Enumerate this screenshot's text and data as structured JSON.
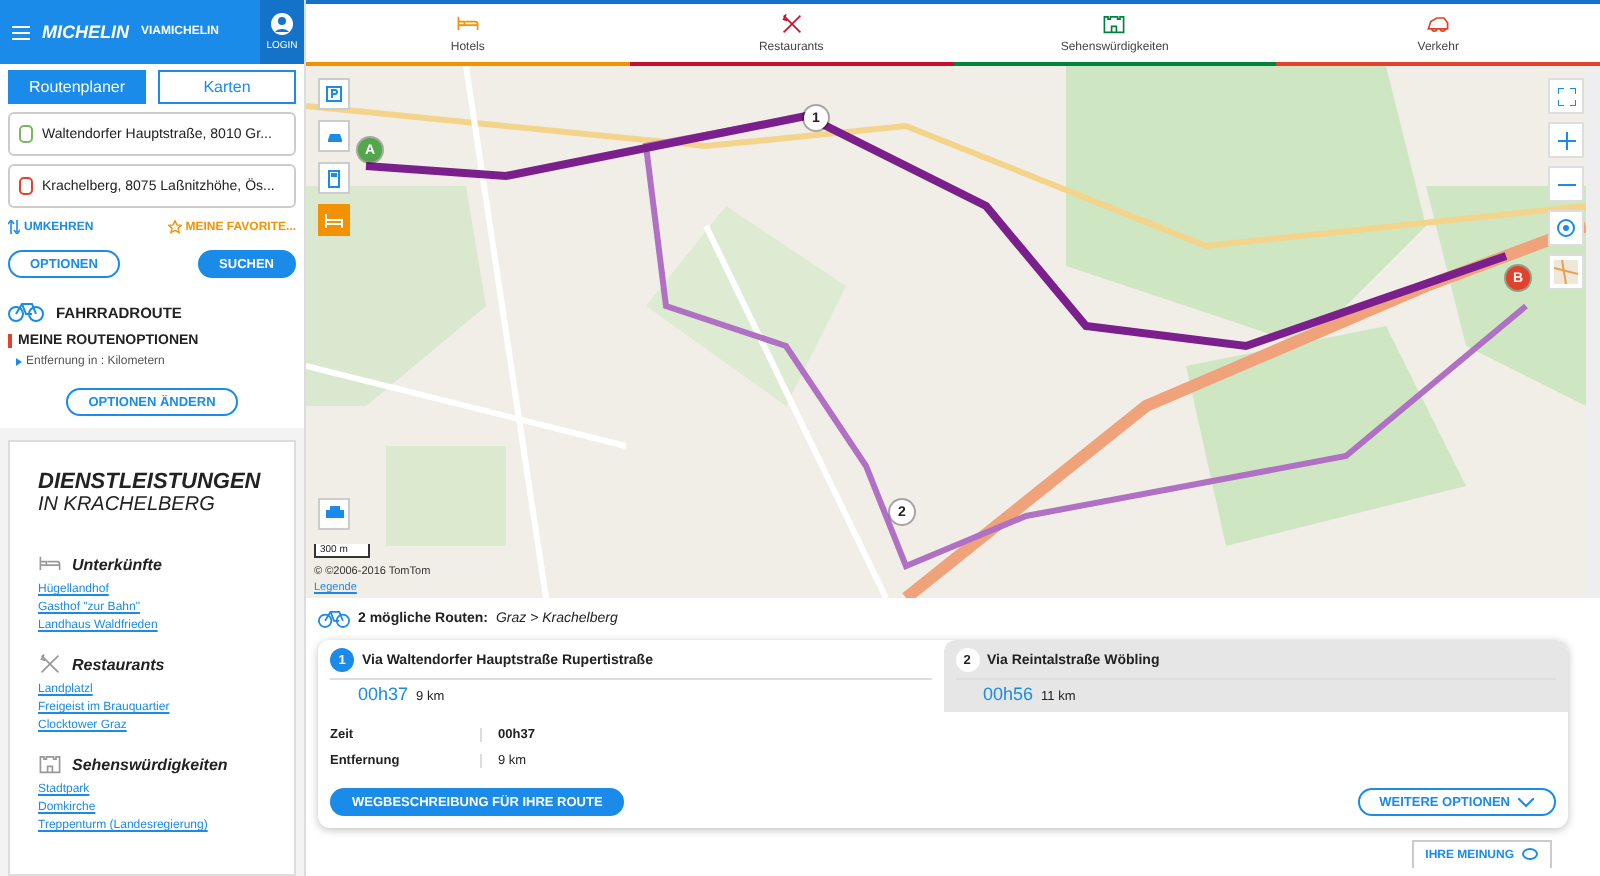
{
  "header": {
    "brand": "MICHELIN",
    "sub": "VIAMICHELIN",
    "login": "LOGIN"
  },
  "modes": [
    {
      "label": "Routenplaner",
      "selected": true
    },
    {
      "label": "Karten",
      "selected": false
    }
  ],
  "stops": [
    {
      "kind": "start",
      "value": "Waltendorfer Hauptstraße, 8010 Gr..."
    },
    {
      "kind": "end",
      "value": "Krachelberg, 8075 Laßnitzhöhe, Ös..."
    }
  ],
  "swap": "UMKEHREN",
  "favorites": "MEINE FAVORITE...",
  "options_button": "OPTIONEN",
  "search_button": "SUCHEN",
  "route_type": "FAHRRADROUTE",
  "route_options": {
    "title": "MEINE ROUTENOPTIONEN",
    "items": [
      "Entfernung in : Kilometern"
    ],
    "button": "OPTIONEN ÄNDERN"
  },
  "services": {
    "title": "DIENSTLEISTUNGEN",
    "subtitle": "IN KRACHELBERG",
    "sections": [
      {
        "kind": "hotel",
        "title": "Unterkünfte",
        "links": [
          "Hügellandhof",
          "Gasthof \"zur Bahn\"",
          "Landhaus Waldfrieden"
        ]
      },
      {
        "kind": "restaurant",
        "title": "Restaurants",
        "links": [
          "Landplatzl",
          "Freigeist im Brauquartier",
          "Clocktower Graz"
        ]
      },
      {
        "kind": "sight",
        "title": "Sehenswürdigkeiten",
        "links": [
          "Stadtpark",
          "Domkirche",
          "Treppenturm (Landesregierung)"
        ]
      }
    ]
  },
  "categories": [
    {
      "kind": "hotel",
      "label": "Hotels",
      "color": "#f39200"
    },
    {
      "kind": "restaurant",
      "label": "Restaurants",
      "color": "#c8102e"
    },
    {
      "kind": "sight",
      "label": "Sehenswürdigkeiten",
      "color": "#00843d"
    },
    {
      "kind": "traffic",
      "label": "Verkehr",
      "color": "#e2412b"
    }
  ],
  "map": {
    "markers": [
      {
        "kind": "start",
        "label": "A"
      },
      {
        "kind": "waypoint",
        "label": "1"
      },
      {
        "kind": "waypoint",
        "label": "2"
      },
      {
        "kind": "end",
        "label": "B"
      }
    ],
    "tools": [
      {
        "kind": "parking",
        "selected": false
      },
      {
        "kind": "car",
        "selected": false
      },
      {
        "kind": "fuel",
        "selected": false
      },
      {
        "kind": "hotel",
        "selected": true
      }
    ],
    "scale": "300 m",
    "copyright": "© ©2006-2016 TomTom",
    "legend": "Legende"
  },
  "summary": {
    "count": "2 mögliche Routen:",
    "places": "Graz > Krachelberg"
  },
  "routes": [
    {
      "number": "1",
      "title": "Via Waltendorfer Hauptstraße Rupertistraße",
      "time": "00h37",
      "distance": "9 km",
      "selected": true
    },
    {
      "number": "2",
      "title": "Via Reintalstraße Wöbling",
      "time": "00h56",
      "distance": "11 km",
      "selected": false
    }
  ],
  "details": [
    {
      "label": "Zeit",
      "value": "00h37"
    },
    {
      "label": "Entfernung",
      "value": "9 km"
    }
  ],
  "directions_button": "WEGBESCHREIBUNG FÜR IHRE ROUTE",
  "more_options": "WEITERE OPTIONEN",
  "feedback": "IHRE MEINUNG"
}
